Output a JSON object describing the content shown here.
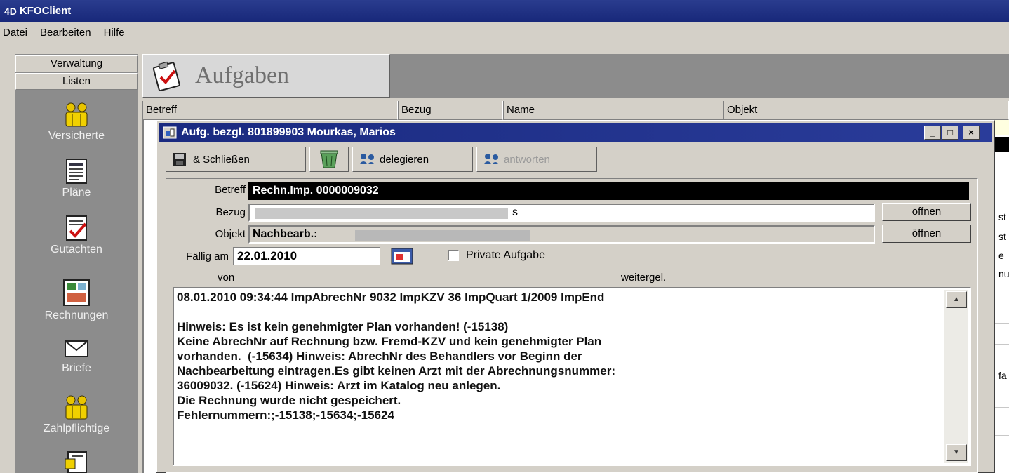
{
  "app": {
    "title": "KFOClient",
    "logo_text": "4D"
  },
  "menu": [
    "Datei",
    "Bearbeiten",
    "Hilfe"
  ],
  "sidebar": {
    "tabs": [
      "Verwaltung",
      "Listen"
    ],
    "items": [
      {
        "label": "Versicherte",
        "icon": "people-group-icon"
      },
      {
        "label": "Pläne",
        "icon": "document-plan-icon"
      },
      {
        "label": "Gutachten",
        "icon": "document-check-icon"
      },
      {
        "label": "Rechnungen",
        "icon": "invoice-icon"
      },
      {
        "label": "Briefe",
        "icon": "envelope-icon"
      },
      {
        "label": "Zahlpflichtige",
        "icon": "people-group-icon"
      },
      {
        "label": "",
        "icon": "folder-icon"
      }
    ]
  },
  "header": {
    "title": "Aufgaben",
    "icon": "clipboard-check-icon"
  },
  "columns": [
    "Betreff",
    "Bezug",
    "Name",
    "Objekt"
  ],
  "background_fragments": [
    "st",
    "st",
    "e",
    "nu",
    "fa"
  ],
  "dialog": {
    "title": "Aufg. bezgl. 801899903 Mourkas, Marios",
    "window_buttons": [
      "_",
      "□",
      "×"
    ],
    "toolbar": {
      "save_close": "& Schließen",
      "delegate": "delegieren",
      "answer": "antworten"
    },
    "fields": {
      "betreff_label": "Betreff",
      "betreff_value": "Rechn.Imp. 0000009032",
      "bezug_label": "Bezug",
      "bezug_value": "s",
      "objekt_label": "Objekt",
      "objekt_value": "Nachbearb.: ",
      "open_button": "öffnen",
      "faellig_label": "Fällig am",
      "faellig_value": "22.01.2010",
      "private_label": "Private Aufgabe",
      "von_label": "von",
      "weitergel_label": "weitergel."
    },
    "memo": "08.01.2010 09:34:44 ImpAbrechNr 9032 ImpKZV 36 ImpQuart 1/2009 ImpEnd\n\nHinweis: Es ist kein genehmigter Plan vorhanden! (-15138)\nKeine AbrechNr auf Rechnung bzw. Fremd-KZV und kein genehmigter Plan\nvorhanden.  (-15634) Hinweis: AbrechNr des Behandlers vor Beginn der\nNachbearbeitung eintragen.Es gibt keinen Arzt mit der Abrechnungsnummer:\n36009032. (-15624) Hinweis: Arzt im Katalog neu anlegen.\nDie Rechnung wurde nicht gespeichert.\nFehlernummern:;-15138;-15634;-15624"
  }
}
